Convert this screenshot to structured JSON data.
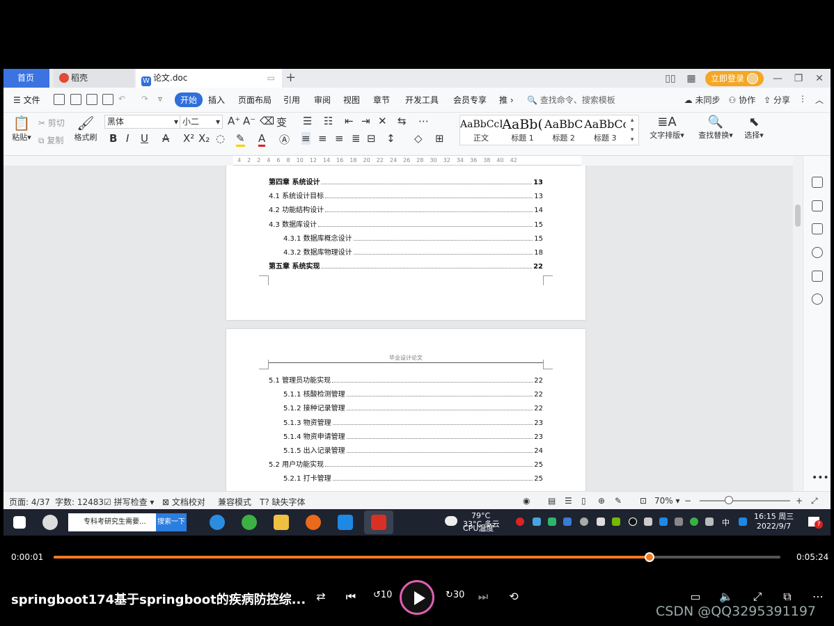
{
  "wps": {
    "tabs": [
      {
        "label": "首页"
      },
      {
        "label": "稻壳"
      },
      {
        "label": "论文.doc"
      }
    ],
    "login_label": "立即登录",
    "menu": [
      "文件",
      "开始",
      "插入",
      "页面布局",
      "引用",
      "审阅",
      "视图",
      "章节",
      "开发工具",
      "会员专享",
      "推"
    ],
    "search_placeholder": "查找命令、搜索模板",
    "right_menu": [
      "未同步",
      "协作",
      "分享"
    ],
    "ribbon": {
      "paste": "粘贴",
      "cut": "剪切",
      "copy": "复制",
      "format_painter": "格式刷",
      "font_name": "黑体",
      "font_size": "小二",
      "styles": [
        {
          "sample": "AaBbCcI",
          "name": "正文"
        },
        {
          "sample": "AaBb(",
          "name": "标题 1"
        },
        {
          "sample": "AaBbC",
          "name": "标题 2"
        },
        {
          "sample": "AaBbCc",
          "name": "标题 3"
        }
      ],
      "text_layout": "文字排版",
      "find_replace": "查找替换",
      "select": "选择"
    },
    "ruler_ticks": [
      "4",
      "2",
      "2",
      "4",
      "6",
      "8",
      "10",
      "12",
      "14",
      "16",
      "18",
      "20",
      "22",
      "24",
      "26",
      "28",
      "30",
      "32",
      "34",
      "36",
      "38",
      "40",
      "42"
    ],
    "page1_toc": [
      {
        "label": "第四章  系统设计",
        "page": "13",
        "level": 1,
        "bold": true
      },
      {
        "label": "4.1  系统设计目标",
        "page": "13",
        "level": 1,
        "bold": false
      },
      {
        "label": "4.2  功能结构设计",
        "page": "14",
        "level": 1,
        "bold": false
      },
      {
        "label": "4.3  数据库设计",
        "page": "15",
        "level": 1,
        "bold": false
      },
      {
        "label": "4.3.1  数据库概念设计",
        "page": "15",
        "level": 2,
        "bold": false
      },
      {
        "label": "4.3.2  数据库物理设计",
        "page": "18",
        "level": 2,
        "bold": false
      },
      {
        "label": "第五章  系统实现",
        "page": "22",
        "level": 1,
        "bold": true
      }
    ],
    "page2_header": "毕业设计论文",
    "page2_toc": [
      {
        "label": "5.1  管理员功能实现",
        "page": "22",
        "level": 1
      },
      {
        "label": "5.1.1  核酸检测管理",
        "page": "22",
        "level": 2
      },
      {
        "label": "5.1.2  接种记录管理",
        "page": "22",
        "level": 2
      },
      {
        "label": "5.1.3  物资管理",
        "page": "23",
        "level": 2
      },
      {
        "label": "5.1.4  物资申请管理",
        "page": "23",
        "level": 2
      },
      {
        "label": "5.1.5  出入记录管理",
        "page": "24",
        "level": 2
      },
      {
        "label": "5.2  用户功能实现",
        "page": "25",
        "level": 1
      },
      {
        "label": "5.2.1  打卡管理",
        "page": "25",
        "level": 2
      }
    ],
    "status": {
      "page": "页面: 4/37",
      "words": "字数: 12483",
      "spell_check": "拼写检查",
      "doc_check": "文档校对",
      "compat_mode": "兼容模式",
      "missing_font": "缺失字体",
      "zoom": "70%"
    }
  },
  "taskbar": {
    "search_text": "专科考研究生需要...",
    "search_button": "搜索一下",
    "weather_temp": "33°C 多云",
    "cpu_temp": "79°C",
    "cpu_label": "CPU温度",
    "ime": "中",
    "time": "16:15 周三",
    "date": "2022/9/7",
    "notification_count": "7"
  },
  "player": {
    "current_time": "0:00:01",
    "total_time": "0:05:24",
    "progress": 0.82,
    "title": "springboot174基于springboot的疾病防控综...",
    "skip_back": "10",
    "skip_forward": "30",
    "watermark": "CSDN @QQ3295391197",
    "colors": {
      "accent": "#f07a23",
      "play_ring": "#e05fb0"
    }
  }
}
